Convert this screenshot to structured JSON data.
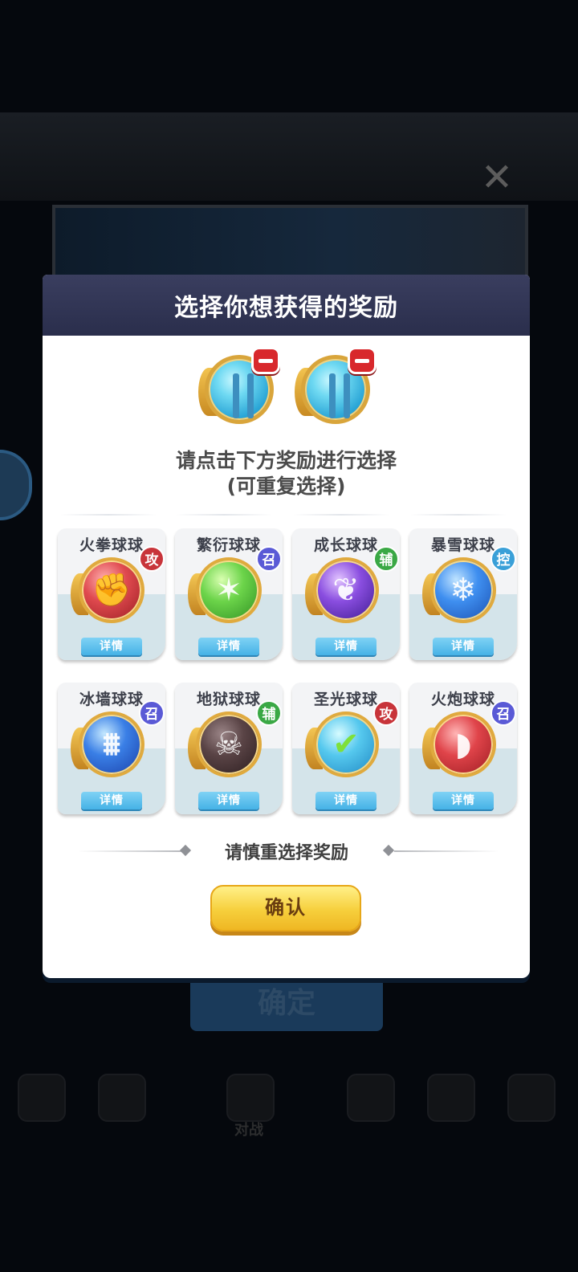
{
  "background": {
    "confirm_label": "确定",
    "nav_label": "对战"
  },
  "modal": {
    "title": "选择你想获得的奖励",
    "instruction": "请点击下方奖励进行选择",
    "instruction_sub": "(可重复选择)",
    "caution": "请慎重选择奖励",
    "confirm_label": "确认",
    "selected_slots": [
      {
        "icon": "holy-light-ball-icon"
      },
      {
        "icon": "holy-light-ball-icon"
      }
    ],
    "rewards": [
      {
        "name": "火拳球球",
        "tag": "攻",
        "tag_color": "#c8343a",
        "orb_color": "#c8343a",
        "glyph": "✊",
        "detail": "详情"
      },
      {
        "name": "繁衍球球",
        "tag": "召",
        "tag_color": "#5a5ad6",
        "orb_color": "#4fc13b",
        "glyph": "✶",
        "detail": "详情"
      },
      {
        "name": "成长球球",
        "tag": "辅",
        "tag_color": "#3aa845",
        "orb_color": "#6b3bc8",
        "glyph": "❦",
        "detail": "详情"
      },
      {
        "name": "暴雪球球",
        "tag": "控",
        "tag_color": "#3aa0d8",
        "orb_color": "#2a6fd8",
        "glyph": "❄",
        "detail": "详情"
      },
      {
        "name": "冰墙球球",
        "tag": "召",
        "tag_color": "#5a5ad6",
        "orb_color": "#2a5fd0",
        "glyph": "⩩",
        "detail": "详情"
      },
      {
        "name": "地狱球球",
        "tag": "辅",
        "tag_color": "#3aa845",
        "orb_color": "#4a3638",
        "glyph": "☠",
        "detail": "详情"
      },
      {
        "name": "圣光球球",
        "tag": "攻",
        "tag_color": "#c8343a",
        "orb_color": "#3fb9e6",
        "glyph": "✔",
        "detail": "详情"
      },
      {
        "name": "火炮球球",
        "tag": "召",
        "tag_color": "#5a5ad6",
        "orb_color": "#d6343a",
        "glyph": "◗",
        "detail": "详情"
      }
    ]
  }
}
